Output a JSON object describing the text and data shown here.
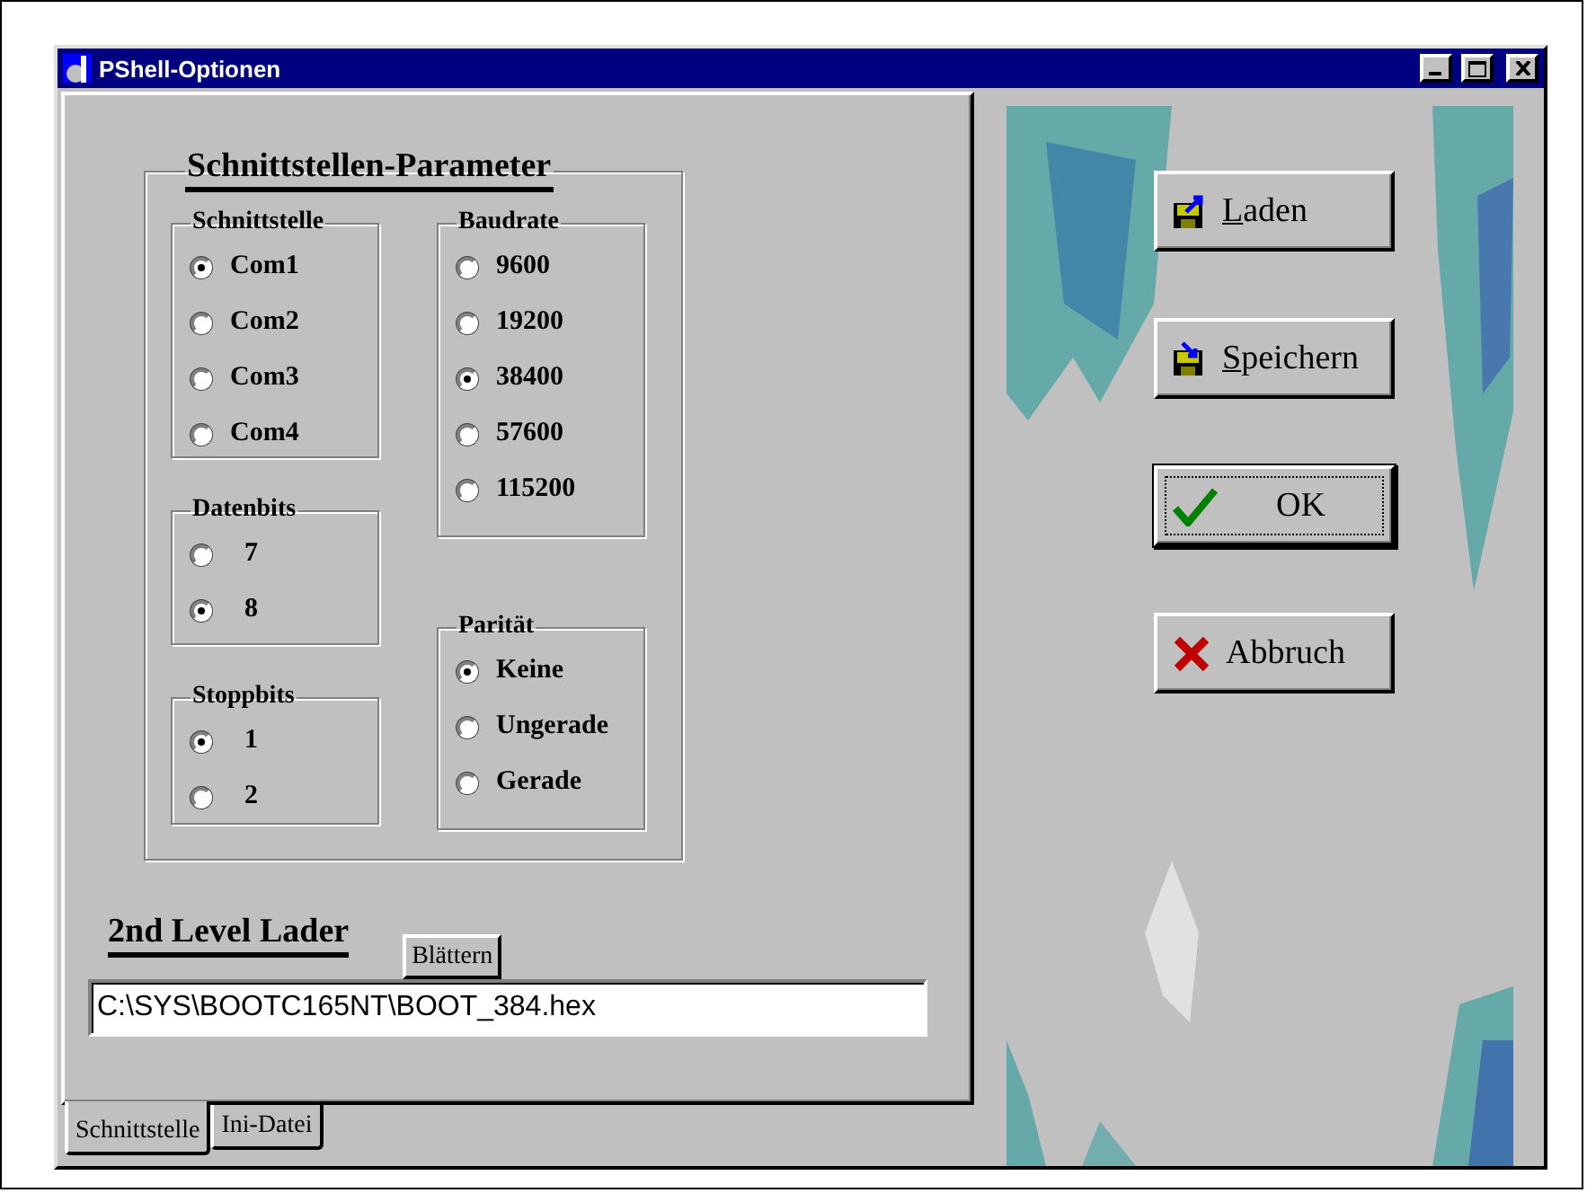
{
  "window": {
    "title": "PShell-Optionen"
  },
  "parameters": {
    "title": "Schnittstellen-Parameter",
    "columns": [
      {
        "groups": [
          {
            "title": "Schnittstelle",
            "options": [
              {
                "label": "Com1",
                "selected": true
              },
              {
                "label": "Com2",
                "selected": false
              },
              {
                "label": "Com3",
                "selected": false
              },
              {
                "label": "Com4",
                "selected": false
              }
            ]
          },
          {
            "title": "Datenbits",
            "options": [
              {
                "label": "7",
                "selected": false
              },
              {
                "label": "8",
                "selected": true
              }
            ]
          },
          {
            "title": "Stoppbits",
            "options": [
              {
                "label": "1",
                "selected": true
              },
              {
                "label": "2",
                "selected": false
              }
            ]
          }
        ]
      },
      {
        "groups": [
          {
            "title": "Baudrate",
            "options": [
              {
                "label": "9600",
                "selected": false
              },
              {
                "label": "19200",
                "selected": false
              },
              {
                "label": "38400",
                "selected": true
              },
              {
                "label": "57600",
                "selected": false
              },
              {
                "label": "115200",
                "selected": false
              }
            ]
          },
          {
            "title": "Parität",
            "options": [
              {
                "label": "Keine",
                "selected": true
              },
              {
                "label": "Ungerade",
                "selected": false
              },
              {
                "label": "Gerade",
                "selected": false
              }
            ]
          }
        ]
      }
    ]
  },
  "loader": {
    "title": "2nd Level Lader",
    "browse_button": "Blättern",
    "path": "C:\\SYS\\BOOTC165NT\\BOOT_384.hex"
  },
  "tabs": [
    {
      "label": "Schnittstelle",
      "selected": true
    },
    {
      "label": "Ini-Datei",
      "selected": false
    }
  ],
  "buttons": [
    {
      "label": "Laden",
      "kind": "load",
      "mnemonic": true,
      "default": false
    },
    {
      "label": "Speichern",
      "kind": "save",
      "mnemonic": true,
      "default": false
    },
    {
      "label": "OK",
      "kind": "ok",
      "mnemonic": false,
      "default": true
    },
    {
      "label": "Abbruch",
      "kind": "cancel",
      "mnemonic": false,
      "default": false
    }
  ]
}
